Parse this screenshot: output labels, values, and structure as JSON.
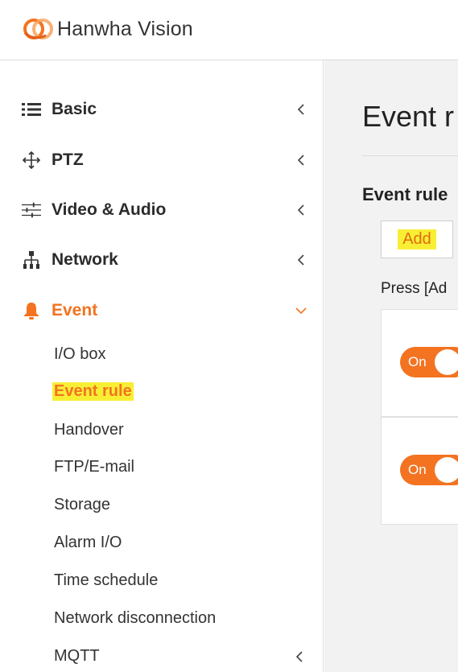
{
  "header": {
    "brand": "Hanwha Vision"
  },
  "colors": {
    "accent": "#f37321",
    "highlight": "#f8ef35"
  },
  "sidebar": {
    "menu": [
      {
        "label": "Basic",
        "icon": "list-icon",
        "expanded": false
      },
      {
        "label": "PTZ",
        "icon": "move-arrows-icon",
        "expanded": false
      },
      {
        "label": "Video & Audio",
        "icon": "sliders-icon",
        "expanded": false
      },
      {
        "label": "Network",
        "icon": "network-tree-icon",
        "expanded": false
      },
      {
        "label": "Event",
        "icon": "bell-icon",
        "expanded": true
      }
    ],
    "event_submenu": [
      {
        "label": "I/O box"
      },
      {
        "label": "Event rule",
        "current": true
      },
      {
        "label": "Handover"
      },
      {
        "label": "FTP/E-mail"
      },
      {
        "label": "Storage"
      },
      {
        "label": "Alarm I/O"
      },
      {
        "label": "Time schedule"
      },
      {
        "label": "Network disconnection"
      },
      {
        "label": "MQTT",
        "has_children": true
      }
    ]
  },
  "main": {
    "page_title": "Event r",
    "section_title": "Event rule",
    "add_button": "Add",
    "hint": "Press [Ad",
    "rules": [
      {
        "toggle_label": "On",
        "enabled": true
      },
      {
        "toggle_label": "On",
        "enabled": true
      }
    ]
  }
}
